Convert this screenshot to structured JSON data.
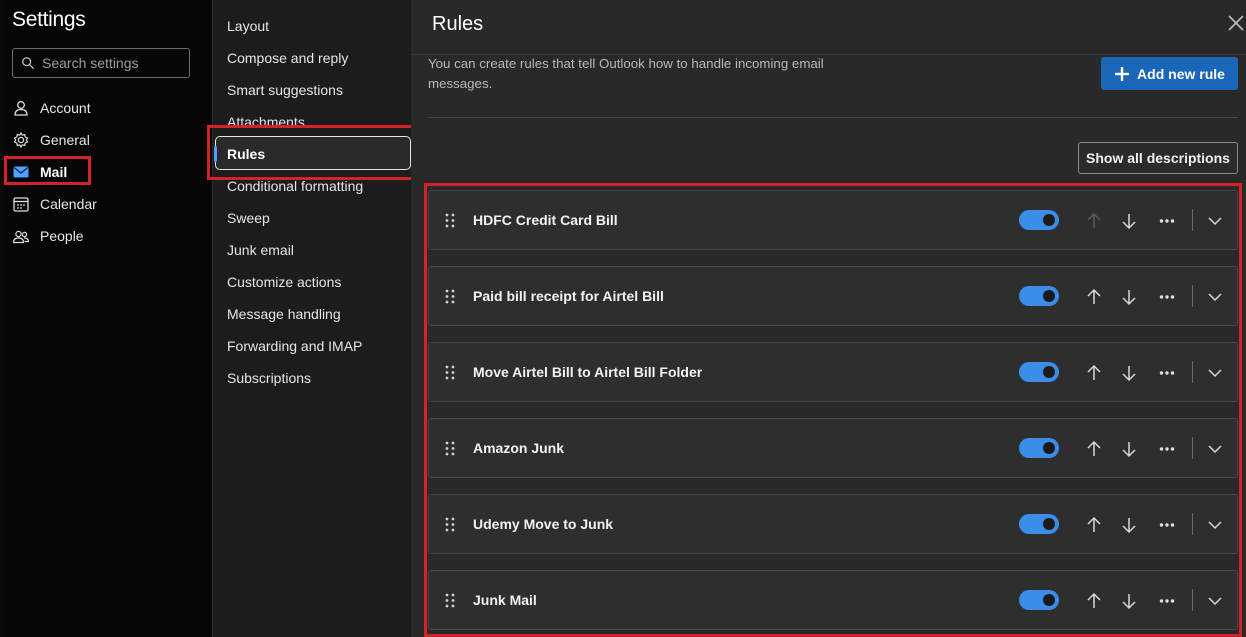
{
  "sidebar": {
    "title": "Settings",
    "search_placeholder": "Search settings",
    "items": [
      {
        "label": "Account",
        "icon": "person-icon"
      },
      {
        "label": "General",
        "icon": "gear-icon"
      },
      {
        "label": "Mail",
        "icon": "mail-icon"
      },
      {
        "label": "Calendar",
        "icon": "calendar-icon"
      },
      {
        "label": "People",
        "icon": "people-icon"
      }
    ]
  },
  "submenu": {
    "items": [
      "Layout",
      "Compose and reply",
      "Smart suggestions",
      "Attachments",
      "Rules",
      "Conditional formatting",
      "Sweep",
      "Junk email",
      "Customize actions",
      "Message handling",
      "Forwarding and IMAP",
      "Subscriptions"
    ],
    "selected": "Rules"
  },
  "panel": {
    "title": "Rules",
    "description": "You can create rules that tell Outlook how to handle incoming email messages.",
    "add_button": "Add new rule",
    "show_all_button": "Show all descriptions",
    "accent_color": "#1a66b8",
    "toggle_color": "#3b8ee8",
    "highlight_color": "#d2232a"
  },
  "rules": [
    {
      "name": "HDFC Credit Card Bill",
      "enabled": true
    },
    {
      "name": "Paid bill receipt for Airtel Bill",
      "enabled": true
    },
    {
      "name": "Move Airtel Bill to Airtel Bill Folder",
      "enabled": true
    },
    {
      "name": "Amazon Junk",
      "enabled": true
    },
    {
      "name": "Udemy Move to Junk",
      "enabled": true
    },
    {
      "name": "Junk Mail",
      "enabled": true
    }
  ]
}
